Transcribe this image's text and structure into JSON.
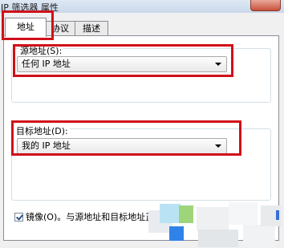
{
  "window": {
    "title": "IP 筛选器 属性"
  },
  "tabs": [
    {
      "label": "地址",
      "active": true
    },
    {
      "label": "协议",
      "active": false
    },
    {
      "label": "描述",
      "active": false
    }
  ],
  "source": {
    "label": "源地址(S):",
    "value": "任何 IP 地址"
  },
  "destination": {
    "label": "目标地址(D):",
    "value": "我的 IP 地址"
  },
  "mirror": {
    "checked": true,
    "label": "镜像(O)。与源地址和目标地址正"
  },
  "colors": {
    "highlight_border": "#d0101a",
    "check_blue": "#2a4f8a"
  }
}
